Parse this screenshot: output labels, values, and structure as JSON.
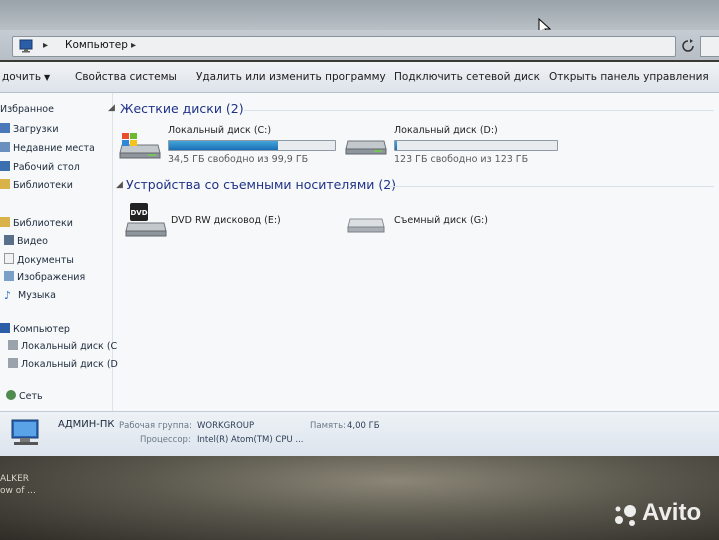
{
  "address": {
    "crumb": "Компьютер"
  },
  "toolbar": {
    "organize": "дочить",
    "system_properties": "Свойства системы",
    "uninstall": "Удалить или изменить программу",
    "map_drive": "Подключить сетевой диск",
    "control_panel": "Открыть панель управления"
  },
  "nav": {
    "favorites": "Избранное",
    "downloads": "Загрузки",
    "recent_places": "Недавние места",
    "desktop": "Рабочий стол",
    "libraries_fav": "Библиотеки",
    "libraries": "Библиотеки",
    "video": "Видео",
    "documents": "Документы",
    "images": "Изображения",
    "music": "Музыка",
    "computer": "Компьютер",
    "disk_c": "Локальный диск (С",
    "disk_d": "Локальный диск (D",
    "network": "Сеть"
  },
  "groups": {
    "hdd_header": "Жесткие диски (2)",
    "removable_header": "Устройства со съемными носителями (2)"
  },
  "drives": {
    "c": {
      "name": "Локальный диск (C:)",
      "free": "34,5 ГБ свободно из 99,9 ГБ",
      "used_fraction": 0.655
    },
    "d": {
      "name": "Локальный диск (D:)",
      "free": "123 ГБ свободно из 123 ГБ",
      "used_fraction": 0.01
    },
    "e": {
      "name": "DVD RW дисковод (E:)",
      "icon_label": "DVD"
    },
    "g": {
      "name": "Съемный диск (G:)"
    }
  },
  "details": {
    "pc_name": "АДМИН-ПК",
    "workgroup_label": "Рабочая группа:",
    "workgroup_value": "WORKGROUP",
    "memory_label": "Память:",
    "memory_value": "4,00 ГБ",
    "cpu_label": "Процессор:",
    "cpu_value": "Intel(R) Atom(TM) CPU ..."
  },
  "desktop": {
    "icon_text1": "ALKER",
    "icon_text2": "ow of ...",
    "watermark": "Avito"
  },
  "colors": {
    "group_header": "#1e3287",
    "bar_fill": "#1b6fb5",
    "toolbar_bg": "#e8ecf1"
  }
}
